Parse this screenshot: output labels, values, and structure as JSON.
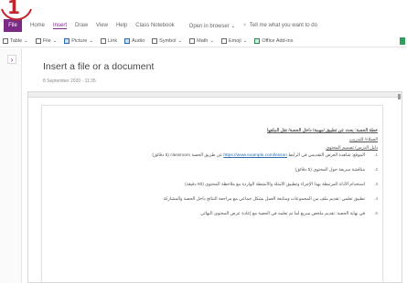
{
  "step_number": "1",
  "menubar": {
    "file": "File",
    "tabs": [
      "Home",
      "Insert",
      "Draw",
      "View",
      "Help",
      "Class Notebook"
    ],
    "active_tab": "Insert",
    "open_in_browser": "Open in browser",
    "tell_me": "Tell me what you want to do"
  },
  "ribbon": {
    "table": "Table",
    "file": "File",
    "picture": "Picture",
    "link": "Link",
    "audio": "Audio",
    "symbol": "Symbol",
    "math": "Math",
    "emoji": "Emoji",
    "office_add_ins": "Office Add-ins"
  },
  "page": {
    "title": "Insert a file or a document",
    "meta": "8 September 2020 · 11:35"
  },
  "document": {
    "heading": "خطة الحصة: بحث عن تطبيق /مهمة/ داخل الحصة/ نقل الملفها",
    "line1": "العملاء/ للتدريب",
    "line2": "دليل الدرس/ تصميم المحتوى",
    "items": [
      {
        "num": "1.",
        "text": "الموقع: شاهدة العرض التقديمي في الرابط",
        "link": "https://www.example.com/lesson",
        "text2": "عن طريق الحصة classroom (5 دقائق)"
      },
      {
        "num": "2.",
        "text": "مناقشة سريعة حول المحتوى (5 دقائق)"
      },
      {
        "num": "3.",
        "text": "استخدام الأداة المرتبطة بهذا الإجراء وتطبيق الأمثلة والأنشطة الواردة مع ملاحظة المحتوى (60 دقيقة)"
      },
      {
        "num": "4.",
        "text": "تطبيق تعلمي: تقديم ملف من المجموعات ومتابعة العمل بشكل جماعي مع مراجعة النتائج داخل الحصة والمشاركة"
      },
      {
        "num": "5.",
        "text": "في نهاية الحصة: تقديم ملخص سريع لما تم تعلمه في الحصة مع إعادة عرض المحتوى النهائي"
      }
    ]
  }
}
